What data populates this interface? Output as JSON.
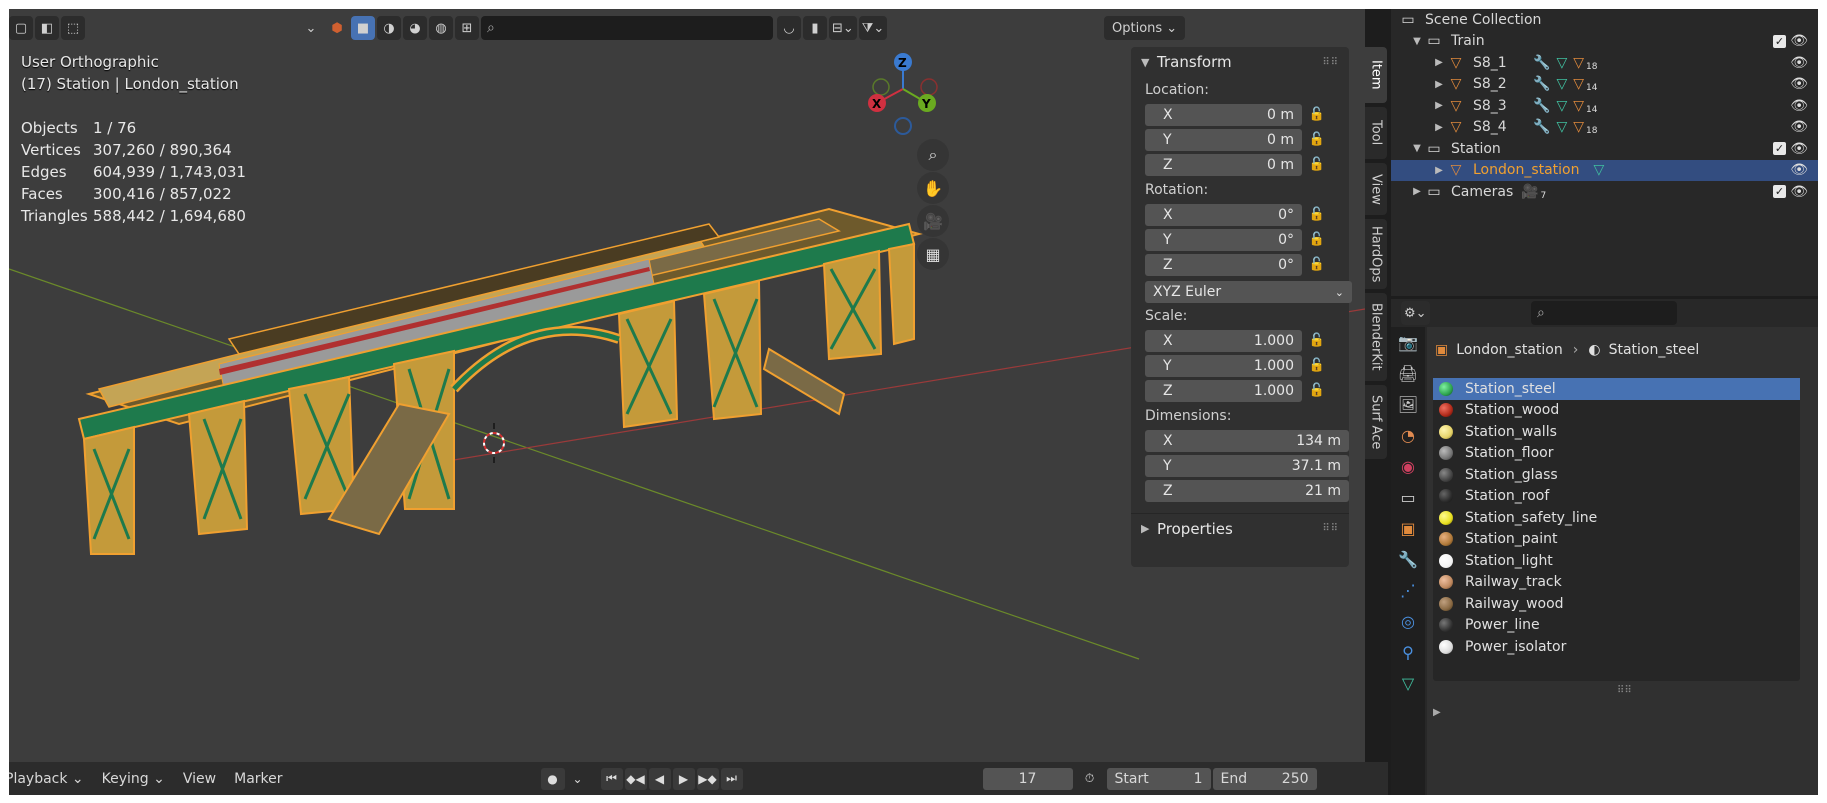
{
  "viewport": {
    "view_name": "User Orthographic",
    "context": "(17) Station | London_station",
    "stats": [
      {
        "label": "Objects",
        "value": "1 / 76"
      },
      {
        "label": "Vertices",
        "value": "307,260 / 890,364"
      },
      {
        "label": "Edges",
        "value": "604,939 / 1,743,031"
      },
      {
        "label": "Faces",
        "value": "300,416 / 857,022"
      },
      {
        "label": "Triangles",
        "value": "588,442 / 1,694,680"
      }
    ],
    "options_label": "Options",
    "gizmo": {
      "x": "X",
      "y": "Y",
      "z": "Z"
    }
  },
  "npanel": {
    "transform_title": "Transform",
    "location_label": "Location:",
    "location": [
      {
        "axis": "X",
        "value": "0 m"
      },
      {
        "axis": "Y",
        "value": "0 m"
      },
      {
        "axis": "Z",
        "value": "0 m"
      }
    ],
    "rotation_label": "Rotation:",
    "rotation": [
      {
        "axis": "X",
        "value": "0°"
      },
      {
        "axis": "Y",
        "value": "0°"
      },
      {
        "axis": "Z",
        "value": "0°"
      }
    ],
    "rotation_mode": "XYZ Euler",
    "scale_label": "Scale:",
    "scale": [
      {
        "axis": "X",
        "value": "1.000"
      },
      {
        "axis": "Y",
        "value": "1.000"
      },
      {
        "axis": "Z",
        "value": "1.000"
      }
    ],
    "dimensions_label": "Dimensions:",
    "dimensions": [
      {
        "axis": "X",
        "value": "134 m"
      },
      {
        "axis": "Y",
        "value": "37.1 m"
      },
      {
        "axis": "Z",
        "value": "21 m"
      }
    ],
    "properties_title": "Properties",
    "tabs": [
      "Item",
      "Tool",
      "View",
      "HardOps",
      "BlenderKit",
      "Surf Ace"
    ]
  },
  "timeline": {
    "menus": [
      "Playback",
      "Keying",
      "View",
      "Marker"
    ],
    "current_frame": "17",
    "start_label": "Start",
    "start_value": "1",
    "end_label": "End",
    "end_value": "250"
  },
  "outliner": {
    "root": "Scene Collection",
    "rows": [
      {
        "name": "Train",
        "kind": "collection"
      },
      {
        "name": "S8_1",
        "kind": "object",
        "count": "18"
      },
      {
        "name": "S8_2",
        "kind": "object",
        "count": "14"
      },
      {
        "name": "S8_3",
        "kind": "object",
        "count": "14"
      },
      {
        "name": "S8_4",
        "kind": "object",
        "count": "18"
      },
      {
        "name": "Station",
        "kind": "collection"
      },
      {
        "name": "London_station",
        "kind": "object"
      },
      {
        "name": "Cameras",
        "kind": "collection",
        "count": "7"
      }
    ]
  },
  "properties": {
    "breadcrumb_object": "London_station",
    "breadcrumb_material": "Station_steel",
    "materials": [
      {
        "name": "Station_steel",
        "color": "#2ea44f"
      },
      {
        "name": "Station_wood",
        "color": "#b02a1a"
      },
      {
        "name": "Station_walls",
        "color": "#e6d36a"
      },
      {
        "name": "Station_floor",
        "color": "#777777"
      },
      {
        "name": "Station_glass",
        "color": "#444444"
      },
      {
        "name": "Station_roof",
        "color": "#2b2b2b"
      },
      {
        "name": "Station_safety_line",
        "color": "#e8e020"
      },
      {
        "name": "Station_paint",
        "color": "#b07a3a"
      },
      {
        "name": "Station_light",
        "color": "#f4f4f4"
      },
      {
        "name": "Railway_track",
        "color": "#c08a60"
      },
      {
        "name": "Railway_wood",
        "color": "#8a6a44"
      },
      {
        "name": "Power_line",
        "color": "#333333"
      },
      {
        "name": "Power_isolator",
        "color": "#dddddd"
      }
    ]
  },
  "colors": {
    "selection_orange": "#f0a030",
    "steel_green": "#1e7a4c",
    "accent_blue": "#4772b3"
  }
}
